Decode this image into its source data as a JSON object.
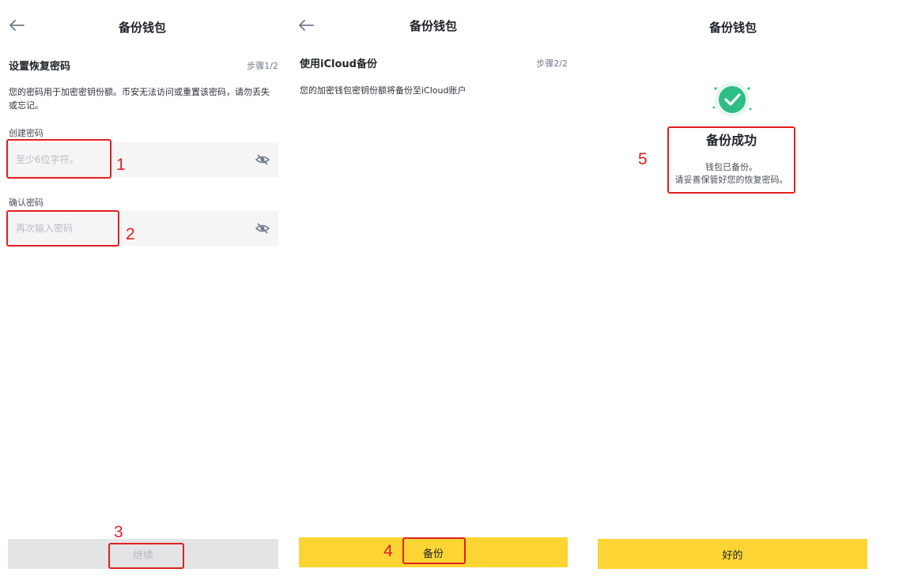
{
  "screen1": {
    "title": "备份钱包",
    "section_title": "设置恢复密码",
    "step": "步骤1/2",
    "description": "您的密码用于加密密钥份额。币安无法访问或重置该密码，请勿丢失或忘记。",
    "create_label": "创建密码",
    "create_placeholder": "至少6位字符。",
    "confirm_label": "确认密码",
    "confirm_placeholder": "再次输入密码",
    "next_button": "继续"
  },
  "screen2": {
    "title": "备份钱包",
    "section_title": "使用iCloud备份",
    "step": "步骤2/2",
    "description": "您的加密钱包密钥份额将备份至iCloud账户",
    "backup_button": "备份"
  },
  "screen3": {
    "title": "备份钱包",
    "success_title": "备份成功",
    "success_line1": "钱包已备份。",
    "success_line2": "请妥善保管好您的恢复密码。",
    "ok_button": "好的"
  },
  "annotations": {
    "n1": "1",
    "n2": "2",
    "n3": "3",
    "n4": "4",
    "n5": "5"
  },
  "icons": {
    "back": "arrow-left-icon",
    "eye": "eye-off-icon",
    "success": "check-circle-icon"
  },
  "colors": {
    "brand_yellow": "#fcd535",
    "success_green": "#2ebd85",
    "annotation_red": "#e02020",
    "disabled_button": "#e3e4e6"
  }
}
